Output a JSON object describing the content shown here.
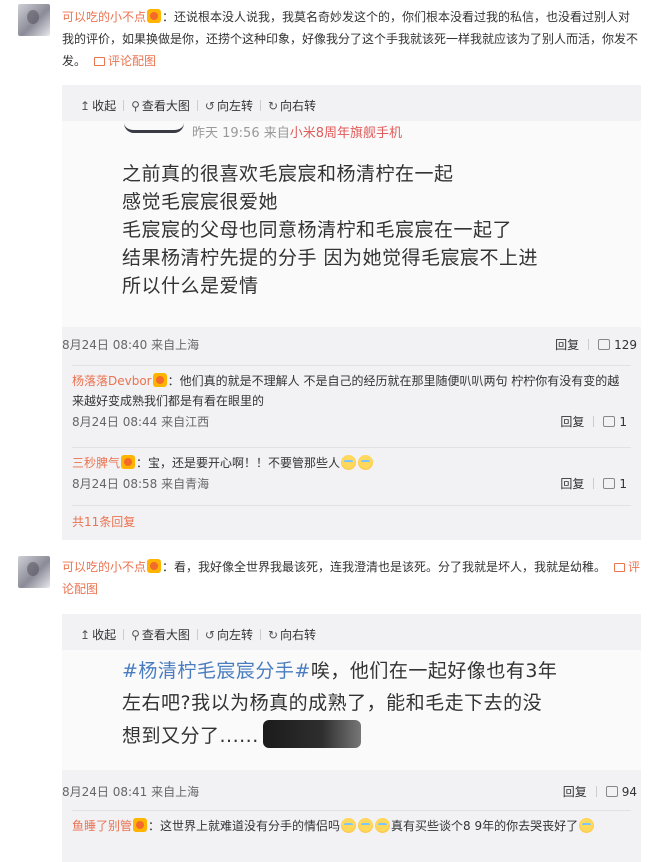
{
  "c1": {
    "user": "可以吃的小不点",
    "text": "：还说根本没人说我，我莫名奇妙发这个的，你们根本没看过我的私信，也没看过别人对我的评价，如果换做是你，还捞个这种印象，好像我分了这个手我就该死一样我就应该为了别人而活，你发不发。",
    "pic_label": "评论配图",
    "toolbar": {
      "collapse": "收起",
      "view_large": "查看大图",
      "rotate_left": "向左转",
      "rotate_right": "向右转"
    },
    "image": {
      "meta_time": "昨天 19:56  来自",
      "meta_device": "小米8周年旗舰手机",
      "lines": [
        "之前真的很喜欢毛宸宸和杨清柠在一起",
        "感觉毛宸宸很爱她",
        "毛宸宸的父母也同意杨清柠和毛宸宸在一起了",
        "结果杨清柠先提的分手 因为她觉得毛宸宸不上进",
        "所以什么是爱情"
      ]
    },
    "time": "8月24日 08:40 来自上海",
    "reply": "回复",
    "likes": "129",
    "subs": [
      {
        "user": "杨落落Devbor",
        "text": "：他们真的就是不理解人 不是自己的经历就在那里随便叭叭两句 柠柠你有没有变的越来越好变成熟我们都是有看在眼里的",
        "time": "8月24日 08:44 来自江西",
        "reply": "回复",
        "likes": "1"
      },
      {
        "user": "三秒脾气",
        "text": "：宝，还是要开心啊！！不要管那些人",
        "time": "8月24日 08:58 来自青海",
        "reply": "回复",
        "likes": "1"
      }
    ],
    "more": "共11条回复"
  },
  "c2": {
    "user": "可以吃的小不点",
    "text": "：看，我好像全世界我最该死，连我澄清也是该死。分了我就是坏人，我就是幼稚。",
    "pic_label": "评论配图",
    "toolbar": {
      "collapse": "收起",
      "view_large": "查看大图",
      "rotate_left": "向左转",
      "rotate_right": "向右转"
    },
    "image": {
      "hashtag": "#杨清柠毛宸宸分手#",
      "line1_rest": "唉，他们在一起好像也有3年",
      "line2": "左右吧?我以为杨真的成熟了，能和毛走下去的没",
      "line3": "想到又分了......"
    },
    "time": "8月24日 08:41 来自上海",
    "reply": "回复",
    "likes": "94",
    "sub": {
      "user": "鱼睡了别管",
      "text_a": "：这世界上就难道没有分手的情侣吗",
      "text_b": "真有买些谈个8 9年的你去哭丧好了"
    }
  },
  "colors": {
    "accent": "#eb7350",
    "panel_bg": "#f2f2f5",
    "hashtag": "#4a7dbf"
  },
  "icons": [
    "collapse-arrow-icon",
    "magnifier-icon",
    "rotate-left-icon",
    "rotate-right-icon",
    "thumb-up-icon",
    "picture-icon",
    "vip-badge-icon",
    "crying-emoji-icon"
  ]
}
